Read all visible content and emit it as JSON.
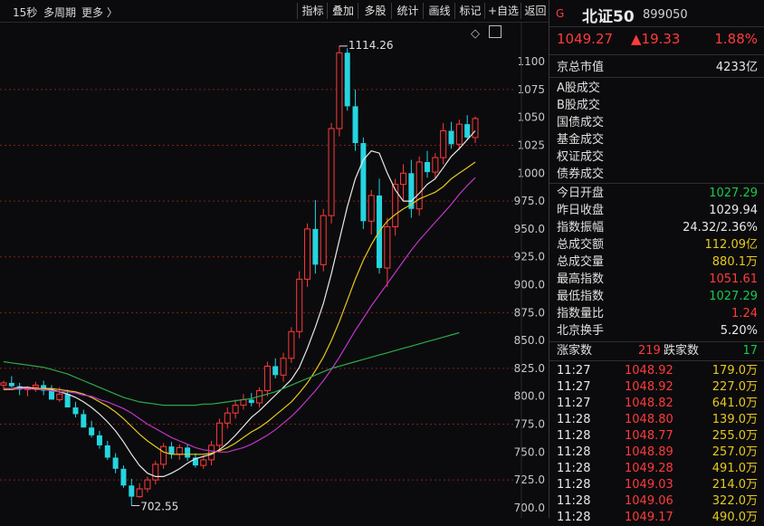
{
  "toolbar": {
    "period": "15秒",
    "multi_period": "多周期",
    "more": "更多 〉",
    "buttons": [
      "指标",
      "叠加",
      "多股",
      "统计",
      "画线",
      "标记",
      "+自选",
      "返回"
    ]
  },
  "chart_data": {
    "type": "candlestick",
    "ylim": [
      691,
      1135
    ],
    "yticks": [
      1100,
      1075,
      1050,
      1025,
      1000,
      975.0,
      950.0,
      925.0,
      900.0,
      875.0,
      850.0,
      825.0,
      800.0,
      775.0,
      750.0,
      725.0,
      700.0
    ],
    "ytick_labels": [
      "1100",
      "1075",
      "1050",
      "1025",
      "1000",
      "975.0",
      "950.0",
      "925.0",
      "900.0",
      "875.0",
      "850.0",
      "825.0",
      "800.0",
      "775.0",
      "750.0",
      "725.0",
      "700.0"
    ],
    "candles": [
      [
        810,
        814,
        806,
        812
      ],
      [
        812,
        818,
        808,
        809
      ],
      [
        809,
        812,
        801,
        806
      ],
      [
        806,
        809,
        800,
        808
      ],
      [
        808,
        813,
        804,
        810
      ],
      [
        810,
        814,
        801,
        805
      ],
      [
        805,
        810,
        800,
        797
      ],
      [
        797,
        808,
        795,
        802
      ],
      [
        802,
        806,
        793,
        790
      ],
      [
        790,
        795,
        781,
        784
      ],
      [
        784,
        788,
        775,
        772
      ],
      [
        772,
        778,
        763,
        765
      ],
      [
        765,
        769,
        753,
        756
      ],
      [
        756,
        760,
        743,
        745
      ],
      [
        745,
        749,
        731,
        735
      ],
      [
        735,
        738,
        718,
        720
      ],
      [
        720,
        726,
        702,
        710
      ],
      [
        710,
        722,
        709,
        717
      ],
      [
        717,
        728,
        714,
        725
      ],
      [
        725,
        742,
        721,
        739
      ],
      [
        739,
        758,
        735,
        755
      ],
      [
        755,
        759,
        744,
        748
      ],
      [
        748,
        757,
        743,
        754
      ],
      [
        754,
        757,
        742,
        745
      ],
      [
        745,
        749,
        736,
        738
      ],
      [
        738,
        747,
        735,
        743
      ],
      [
        743,
        760,
        738,
        756
      ],
      [
        756,
        780,
        751,
        776
      ],
      [
        776,
        790,
        771,
        785
      ],
      [
        785,
        797,
        780,
        792
      ],
      [
        792,
        802,
        788,
        797
      ],
      [
        797,
        803,
        791,
        794
      ],
      [
        794,
        808,
        790,
        805
      ],
      [
        805,
        831,
        800,
        827
      ],
      [
        827,
        834,
        816,
        819
      ],
      [
        819,
        839,
        813,
        834
      ],
      [
        834,
        862,
        830,
        858
      ],
      [
        858,
        912,
        852,
        905
      ],
      [
        905,
        955,
        898,
        950
      ],
      [
        950,
        976,
        910,
        918
      ],
      [
        918,
        968,
        912,
        962
      ],
      [
        962,
        1045,
        955,
        1040
      ],
      [
        1040,
        1114,
        1033,
        1108
      ],
      [
        1108,
        1112,
        1056,
        1060
      ],
      [
        1060,
        1075,
        1020,
        1027
      ],
      [
        1027,
        1032,
        950,
        957
      ],
      [
        957,
        985,
        945,
        980
      ],
      [
        980,
        995,
        910,
        915
      ],
      [
        915,
        960,
        898,
        952
      ],
      [
        952,
        995,
        944,
        990
      ],
      [
        990,
        1008,
        975,
        1000
      ],
      [
        1000,
        1012,
        960,
        968
      ],
      [
        968,
        1015,
        962,
        1010
      ],
      [
        1010,
        1020,
        996,
        1001
      ],
      [
        1001,
        1018,
        995,
        1014
      ],
      [
        1014,
        1045,
        1008,
        1038
      ],
      [
        1038,
        1046,
        1022,
        1026
      ],
      [
        1026,
        1048,
        1021,
        1044
      ],
      [
        1044,
        1052,
        1030,
        1032
      ],
      [
        1032,
        1051,
        1027,
        1049
      ]
    ],
    "ma_lines": [
      {
        "color": "#e8e8e8",
        "values": [
          806,
          807,
          808,
          808,
          807,
          807,
          806,
          804,
          802,
          799,
          795,
          790,
          784,
          777,
          769,
          759,
          748,
          738,
          731,
          728,
          728,
          731,
          735,
          740,
          744,
          746,
          748,
          752,
          758,
          765,
          773,
          781,
          787,
          794,
          801,
          808,
          815,
          826,
          843,
          862,
          883,
          910,
          940,
          970,
          995,
          1012,
          1020,
          1018,
          1000,
          985,
          975,
          975,
          982,
          990,
          995,
          1005,
          1015,
          1022,
          1030,
          1038
        ]
      },
      {
        "color": "#e6c81e",
        "values": [
          806,
          806,
          807,
          807,
          807,
          807,
          807,
          806,
          805,
          804,
          802,
          799,
          795,
          791,
          786,
          780,
          773,
          766,
          760,
          755,
          750,
          748,
          748,
          748,
          748,
          748,
          749,
          751,
          754,
          758,
          763,
          768,
          772,
          777,
          783,
          789,
          795,
          803,
          812,
          823,
          835,
          850,
          867,
          886,
          905,
          922,
          936,
          948,
          957,
          963,
          968,
          972,
          977,
          980,
          983,
          988,
          995,
          1000,
          1005,
          1010
        ]
      },
      {
        "color": "#c035c8",
        "values": [
          807,
          807,
          807,
          807,
          806,
          806,
          805,
          804,
          804,
          803,
          801,
          800,
          797,
          795,
          792,
          789,
          785,
          780,
          775,
          771,
          767,
          763,
          760,
          757,
          754,
          752,
          751,
          750,
          750,
          752,
          754,
          757,
          761,
          765,
          770,
          776,
          782,
          789,
          797,
          805,
          814,
          824,
          835,
          847,
          859,
          870,
          881,
          891,
          901,
          911,
          921,
          931,
          940,
          948,
          956,
          964,
          972,
          981,
          989,
          996
        ]
      },
      {
        "color": "#2fa84a",
        "values": [
          831,
          830,
          829,
          828,
          827,
          826,
          824,
          822,
          820,
          817,
          814,
          811,
          808,
          805,
          802,
          799,
          797,
          795,
          794,
          793,
          792,
          792,
          792,
          792,
          792,
          793,
          793,
          794,
          795,
          796,
          797,
          798,
          800,
          802,
          804,
          807,
          810,
          813,
          816,
          819,
          822,
          825,
          827,
          829,
          831,
          833,
          835,
          837,
          839,
          841,
          843,
          845,
          847,
          849,
          851,
          853,
          855,
          857
        ]
      }
    ],
    "annotations": {
      "high": "1114.26",
      "low": "702.55"
    }
  },
  "quote": {
    "badge": "G",
    "name": "北证50",
    "code": "899050",
    "price": "1049.27",
    "change": "▲19.33",
    "change_pct": "1.88%"
  },
  "market_cap": {
    "label": "京总市值",
    "value": "4233亿"
  },
  "turnover_labels": [
    "A股成交",
    "B股成交",
    "国债成交",
    "基金成交",
    "权证成交",
    "债券成交"
  ],
  "stats": [
    {
      "label": "今日开盘",
      "value": "1027.29",
      "color": "green"
    },
    {
      "label": "昨日收盘",
      "value": "1029.94",
      "color": "white"
    },
    {
      "label": "指数振幅",
      "value": "24.32/2.36%",
      "color": "white"
    },
    {
      "label": "总成交额",
      "value": "112.09亿",
      "color": "yellow"
    },
    {
      "label": "总成交量",
      "value": "880.1万",
      "color": "yellow"
    },
    {
      "label": "最高指数",
      "value": "1051.61",
      "color": "red"
    },
    {
      "label": "最低指数",
      "value": "1027.29",
      "color": "green"
    },
    {
      "label": "指数量比",
      "value": "1.24",
      "color": "red"
    },
    {
      "label": "北京换手",
      "value": "5.20%",
      "color": "white"
    }
  ],
  "breadth": {
    "up_label": "涨家数",
    "up_value": "219",
    "down_label": "跌家数",
    "down_value": "17"
  },
  "ticks": [
    {
      "time": "11:27",
      "price": "1048.92",
      "vol": "179.0万"
    },
    {
      "time": "11:27",
      "price": "1048.92",
      "vol": "227.0万"
    },
    {
      "time": "11:27",
      "price": "1048.82",
      "vol": "641.0万"
    },
    {
      "time": "11:28",
      "price": "1048.80",
      "vol": "139.0万"
    },
    {
      "time": "11:28",
      "price": "1048.77",
      "vol": "255.0万"
    },
    {
      "time": "11:28",
      "price": "1048.89",
      "vol": "257.0万"
    },
    {
      "time": "11:28",
      "price": "1049.28",
      "vol": "491.0万"
    },
    {
      "time": "11:28",
      "price": "1049.03",
      "vol": "214.0万"
    },
    {
      "time": "11:28",
      "price": "1049.06",
      "vol": "322.0万"
    },
    {
      "time": "11:28",
      "price": "1049.17",
      "vol": "490.0万"
    }
  ]
}
